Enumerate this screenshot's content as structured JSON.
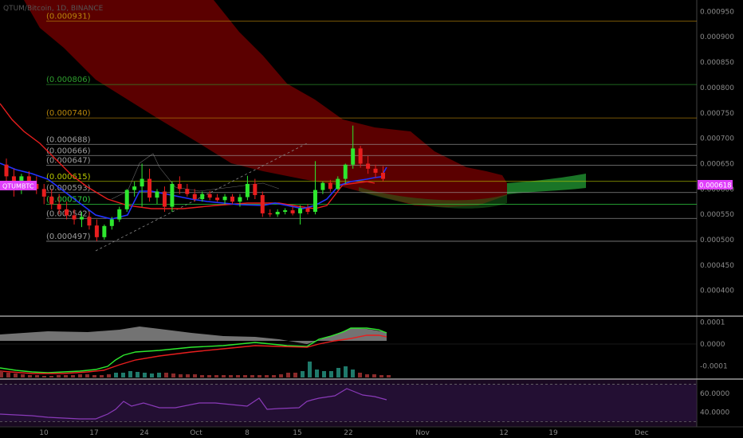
{
  "symbol_header": "QTUM/Bitcoin, 1D, BINANCE",
  "chart_data": [
    {
      "type": "candlestick",
      "title": "QTUM/Bitcoin, 1D, BINANCE",
      "price_tag": {
        "label": "QTUMBTC",
        "value": "0.000618",
        "color": "#e040fb"
      },
      "y_ticks": [
        "0.000950",
        "0.000900",
        "0.000850",
        "0.000800",
        "0.000750",
        "0.000700",
        "0.000650",
        "0.000600",
        "0.000550",
        "0.000500",
        "0.000450",
        "0.000400"
      ],
      "y_tick_values": [
        0.00095,
        0.0009,
        0.00085,
        0.0008,
        0.00075,
        0.0007,
        0.00065,
        0.0006,
        0.00055,
        0.0005,
        0.00045,
        0.0004
      ],
      "ylim": [
        0.000376,
        0.00096
      ],
      "x_ticks": [
        "10",
        "17",
        "24",
        "Oct",
        "8",
        "15",
        "22",
        "Nov",
        "12",
        "19",
        "Dec"
      ],
      "fib_levels": [
        {
          "label": "(0.000931)",
          "value": 0.000931,
          "color": "#b8860b"
        },
        {
          "label": "(0.000806)",
          "value": 0.000806,
          "color": "#2e9e2e"
        },
        {
          "label": "(0.000740)",
          "value": 0.00074,
          "color": "#b8860b"
        },
        {
          "label": "(0.000688)",
          "value": 0.000688,
          "color": "#9e9e9e"
        },
        {
          "label": "(0.000666)",
          "value": 0.000666,
          "color": "#9e9e9e"
        },
        {
          "label": "(0.000647)",
          "value": 0.000647,
          "color": "#9e9e9e"
        },
        {
          "label": "(0.000615)",
          "value": 0.000615,
          "color": "#b8c800"
        },
        {
          "label": "(0.000593)",
          "value": 0.000593,
          "color": "#9e9e9e"
        },
        {
          "label": "(0.000570)",
          "value": 0.00057,
          "color": "#2ecc40"
        },
        {
          "label": "(0.000542)",
          "value": 0.000542,
          "color": "#9e9e9e"
        },
        {
          "label": "(0.000497)",
          "value": 0.000497,
          "color": "#9e9e9e"
        }
      ],
      "candles": [
        {
          "o": 0.000648,
          "h": 0.00066,
          "l": 0.00061,
          "c": 0.000625
        },
        {
          "o": 0.000625,
          "h": 0.00064,
          "l": 0.000585,
          "c": 0.0006
        },
        {
          "o": 0.0006,
          "h": 0.00063,
          "l": 0.00059,
          "c": 0.000625
        },
        {
          "o": 0.000625,
          "h": 0.000635,
          "l": 0.0006,
          "c": 0.00061
        },
        {
          "o": 0.00061,
          "h": 0.000625,
          "l": 0.00059,
          "c": 0.0006
        },
        {
          "o": 0.0006,
          "h": 0.00061,
          "l": 0.00057,
          "c": 0.000585
        },
        {
          "o": 0.000585,
          "h": 0.0006,
          "l": 0.00056,
          "c": 0.00057
        },
        {
          "o": 0.00057,
          "h": 0.00059,
          "l": 0.00055,
          "c": 0.00056
        },
        {
          "o": 0.00056,
          "h": 0.000575,
          "l": 0.00054,
          "c": 0.000548
        },
        {
          "o": 0.000548,
          "h": 0.00056,
          "l": 0.00053,
          "c": 0.00054
        },
        {
          "o": 0.00054,
          "h": 0.000555,
          "l": 0.000525,
          "c": 0.000545
        },
        {
          "o": 0.000545,
          "h": 0.000555,
          "l": 0.00052,
          "c": 0.000528
        },
        {
          "o": 0.000528,
          "h": 0.00054,
          "l": 0.000497,
          "c": 0.000505
        },
        {
          "o": 0.000505,
          "h": 0.00053,
          "l": 0.0005,
          "c": 0.000527
        },
        {
          "o": 0.000527,
          "h": 0.000545,
          "l": 0.00052,
          "c": 0.00054
        },
        {
          "o": 0.00054,
          "h": 0.000565,
          "l": 0.000535,
          "c": 0.00056
        },
        {
          "o": 0.00056,
          "h": 0.0006,
          "l": 0.000555,
          "c": 0.000598
        },
        {
          "o": 0.000598,
          "h": 0.000615,
          "l": 0.000585,
          "c": 0.000605
        },
        {
          "o": 0.000605,
          "h": 0.00065,
          "l": 0.000565,
          "c": 0.00062
        },
        {
          "o": 0.00062,
          "h": 0.00064,
          "l": 0.000575,
          "c": 0.000583
        },
        {
          "o": 0.000583,
          "h": 0.0006,
          "l": 0.00057,
          "c": 0.000595
        },
        {
          "o": 0.000595,
          "h": 0.000605,
          "l": 0.000555,
          "c": 0.000565
        },
        {
          "o": 0.000565,
          "h": 0.000615,
          "l": 0.000555,
          "c": 0.00061
        },
        {
          "o": 0.00061,
          "h": 0.000625,
          "l": 0.00059,
          "c": 0.0006
        },
        {
          "o": 0.0006,
          "h": 0.00061,
          "l": 0.000585,
          "c": 0.00059
        },
        {
          "o": 0.00059,
          "h": 0.0006,
          "l": 0.000575,
          "c": 0.00058
        },
        {
          "o": 0.00058,
          "h": 0.000595,
          "l": 0.000575,
          "c": 0.00059
        },
        {
          "o": 0.00059,
          "h": 0.000596,
          "l": 0.000578,
          "c": 0.000583
        },
        {
          "o": 0.000583,
          "h": 0.00059,
          "l": 0.000575,
          "c": 0.000578
        },
        {
          "o": 0.000578,
          "h": 0.00059,
          "l": 0.00057,
          "c": 0.000585
        },
        {
          "o": 0.000585,
          "h": 0.00059,
          "l": 0.00057,
          "c": 0.000575
        },
        {
          "o": 0.000575,
          "h": 0.00059,
          "l": 0.000565,
          "c": 0.000584
        },
        {
          "o": 0.000584,
          "h": 0.000626,
          "l": 0.000578,
          "c": 0.00061
        },
        {
          "o": 0.00061,
          "h": 0.00062,
          "l": 0.00058,
          "c": 0.000588
        },
        {
          "o": 0.000588,
          "h": 0.000595,
          "l": 0.000545,
          "c": 0.000552
        },
        {
          "o": 0.000552,
          "h": 0.00056,
          "l": 0.000545,
          "c": 0.00055
        },
        {
          "o": 0.00055,
          "h": 0.00056,
          "l": 0.000545,
          "c": 0.000555
        },
        {
          "o": 0.000555,
          "h": 0.000562,
          "l": 0.00055,
          "c": 0.000558
        },
        {
          "o": 0.000558,
          "h": 0.000565,
          "l": 0.000548,
          "c": 0.000552
        },
        {
          "o": 0.000552,
          "h": 0.000568,
          "l": 0.00053,
          "c": 0.000562
        },
        {
          "o": 0.000562,
          "h": 0.00057,
          "l": 0.00055,
          "c": 0.000555
        },
        {
          "o": 0.000555,
          "h": 0.000655,
          "l": 0.00055,
          "c": 0.000598
        },
        {
          "o": 0.000598,
          "h": 0.000615,
          "l": 0.00059,
          "c": 0.000612
        },
        {
          "o": 0.000612,
          "h": 0.000618,
          "l": 0.000595,
          "c": 0.0006
        },
        {
          "o": 0.0006,
          "h": 0.000625,
          "l": 0.000598,
          "c": 0.00062
        },
        {
          "o": 0.00062,
          "h": 0.00065,
          "l": 0.00061,
          "c": 0.000648
        },
        {
          "o": 0.000648,
          "h": 0.000725,
          "l": 0.00064,
          "c": 0.00068
        },
        {
          "o": 0.00068,
          "h": 0.000685,
          "l": 0.000642,
          "c": 0.00065
        },
        {
          "o": 0.00065,
          "h": 0.000665,
          "l": 0.00063,
          "c": 0.00064
        },
        {
          "o": 0.00064,
          "h": 0.000648,
          "l": 0.000622,
          "c": 0.000632
        },
        {
          "o": 0.000632,
          "h": 0.000645,
          "l": 0.000615,
          "c": 0.00062
        }
      ],
      "macd": {
        "y_ticks": [
          "0.0001",
          "0.0000",
          "-0.0001"
        ],
        "y_tick_values": [
          0.0001,
          0,
          -0.0001
        ],
        "ylim": [
          -0.000153,
          0.000113
        ]
      },
      "rsi": {
        "y_ticks": [
          "60.0000",
          "40.0000"
        ],
        "y_tick_values": [
          60,
          40
        ],
        "ylim": [
          26,
          73
        ]
      },
      "colors": {
        "up": "#2ee82e",
        "down": "#e81e1e",
        "cloud": "#6b0000",
        "conv": "#e81e1e",
        "base": "#2233ff",
        "rsi": "#8a3ab9"
      }
    }
  ]
}
